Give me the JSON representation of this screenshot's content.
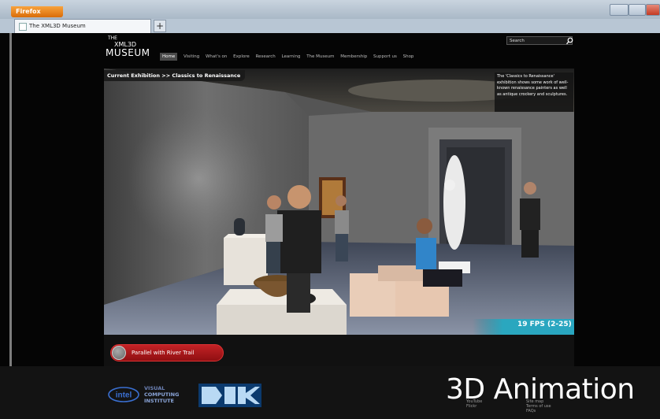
{
  "browser": {
    "menu_button": "Firefox",
    "tab_title": "The XML3D Museum",
    "new_tab": "+"
  },
  "site": {
    "logo_line1": "THE",
    "logo_line2": "XML3D",
    "logo_line3": "MUSEUM",
    "search_placeholder": "Search",
    "nav": [
      "Home",
      "Visiting",
      "What's on",
      "Explore",
      "Research",
      "Learning",
      "The Museum",
      "Membership",
      "Support us",
      "Shop"
    ]
  },
  "exhibit": {
    "breadcrumb": "Current Exhibition >> Classics to Renaissance",
    "description": "The 'Classics to Renaissance' exhibition shows some work of well-known renaissance painters as well as antique crockery and sculptures.",
    "fps": "19 FPS (2-25)"
  },
  "controls": {
    "trail_button": "Parallel with River Trail"
  },
  "footer": {
    "partner1": "intel",
    "partner2_line1": "VISUAL",
    "partner2_line2": "COMPUTING",
    "partner2_line3": "INSTITUTE",
    "partner3": "DFKI",
    "links_col1": [
      "YouTube",
      "Flickr"
    ],
    "links_col2": [
      "Site map",
      "Terms of use",
      "FAQs"
    ]
  },
  "overlay": {
    "caption": "3D Animation"
  },
  "colors": {
    "accent_red": "#b81a1d",
    "firefox_orange": "#e8861f"
  }
}
